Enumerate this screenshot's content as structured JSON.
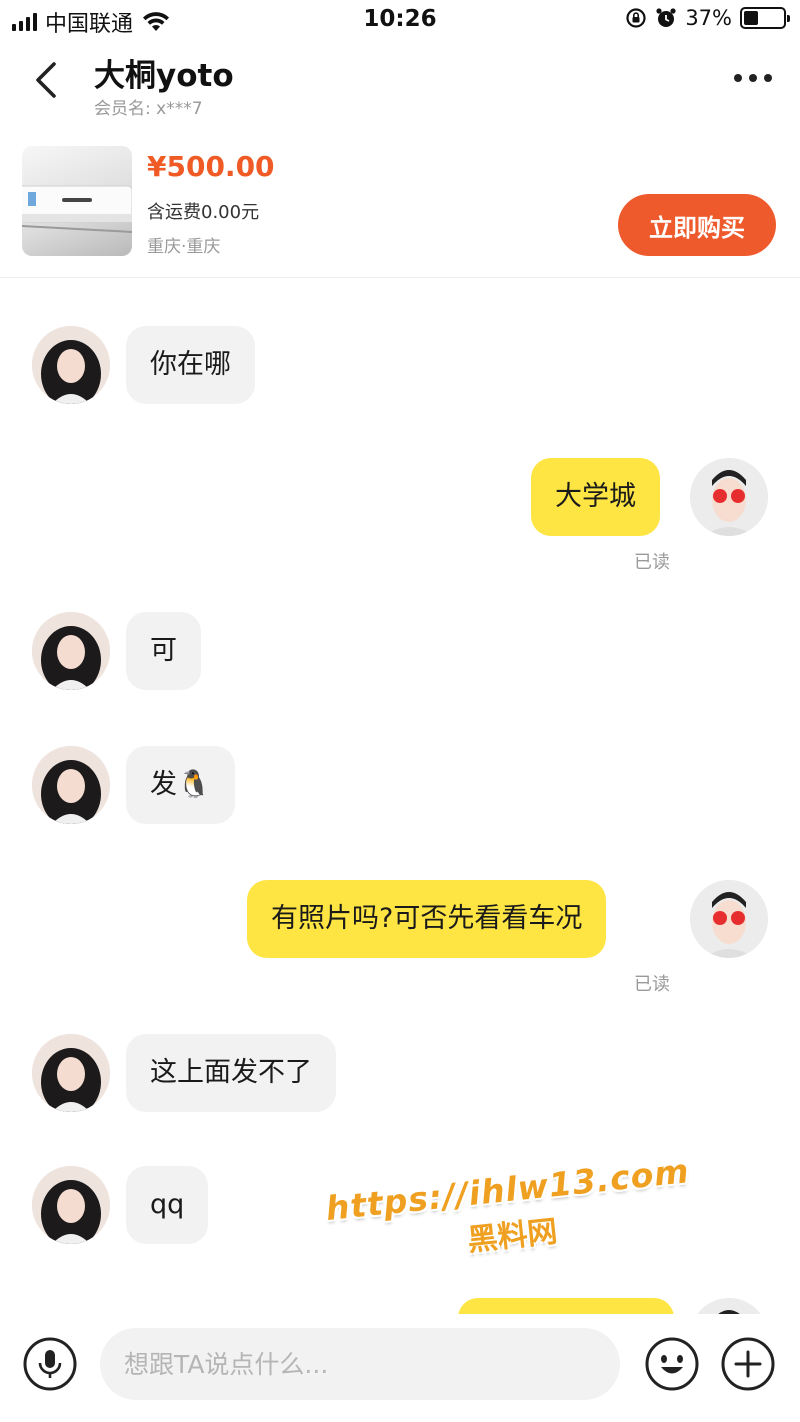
{
  "status_bar": {
    "carrier": "中国联通",
    "time": "10:26",
    "battery_percent_label": "37%",
    "battery_level": 0.37,
    "icons": [
      "signal-icon",
      "wifi-icon",
      "orientation-lock-icon",
      "alarm-icon",
      "battery-icon"
    ]
  },
  "header": {
    "title": "大桐yoto",
    "member_label": "会员名:",
    "member_value": "x***7",
    "icons": [
      "back-arrow-icon",
      "more-dots-icon"
    ]
  },
  "product": {
    "price": "¥500.00",
    "shipping": "含运费0.00元",
    "location": "重庆·重庆",
    "buy_button": "立即购买"
  },
  "messages": [
    {
      "from": "other",
      "text": "你在哪"
    },
    {
      "from": "me",
      "text": "大学城",
      "status": "已读"
    },
    {
      "from": "other",
      "text": "可"
    },
    {
      "from": "other",
      "text": "发🐧"
    },
    {
      "from": "me",
      "text": "有照片吗?可否先看看车况",
      "status": "已读"
    },
    {
      "from": "other",
      "text": "这上面发不了"
    },
    {
      "from": "other",
      "text": "qq"
    }
  ],
  "watermark": {
    "url": "https://ihlw13.com",
    "name": "黑料网"
  },
  "input_bar": {
    "placeholder": "想跟TA说点什么...",
    "icons": [
      "microphone-icon",
      "emoji-icon",
      "plus-icon"
    ]
  },
  "colors": {
    "accent_orange": "#ef5a2c",
    "price_orange": "#f05a24",
    "my_bubble": "#fee543",
    "their_bubble": "#f2f2f2"
  }
}
